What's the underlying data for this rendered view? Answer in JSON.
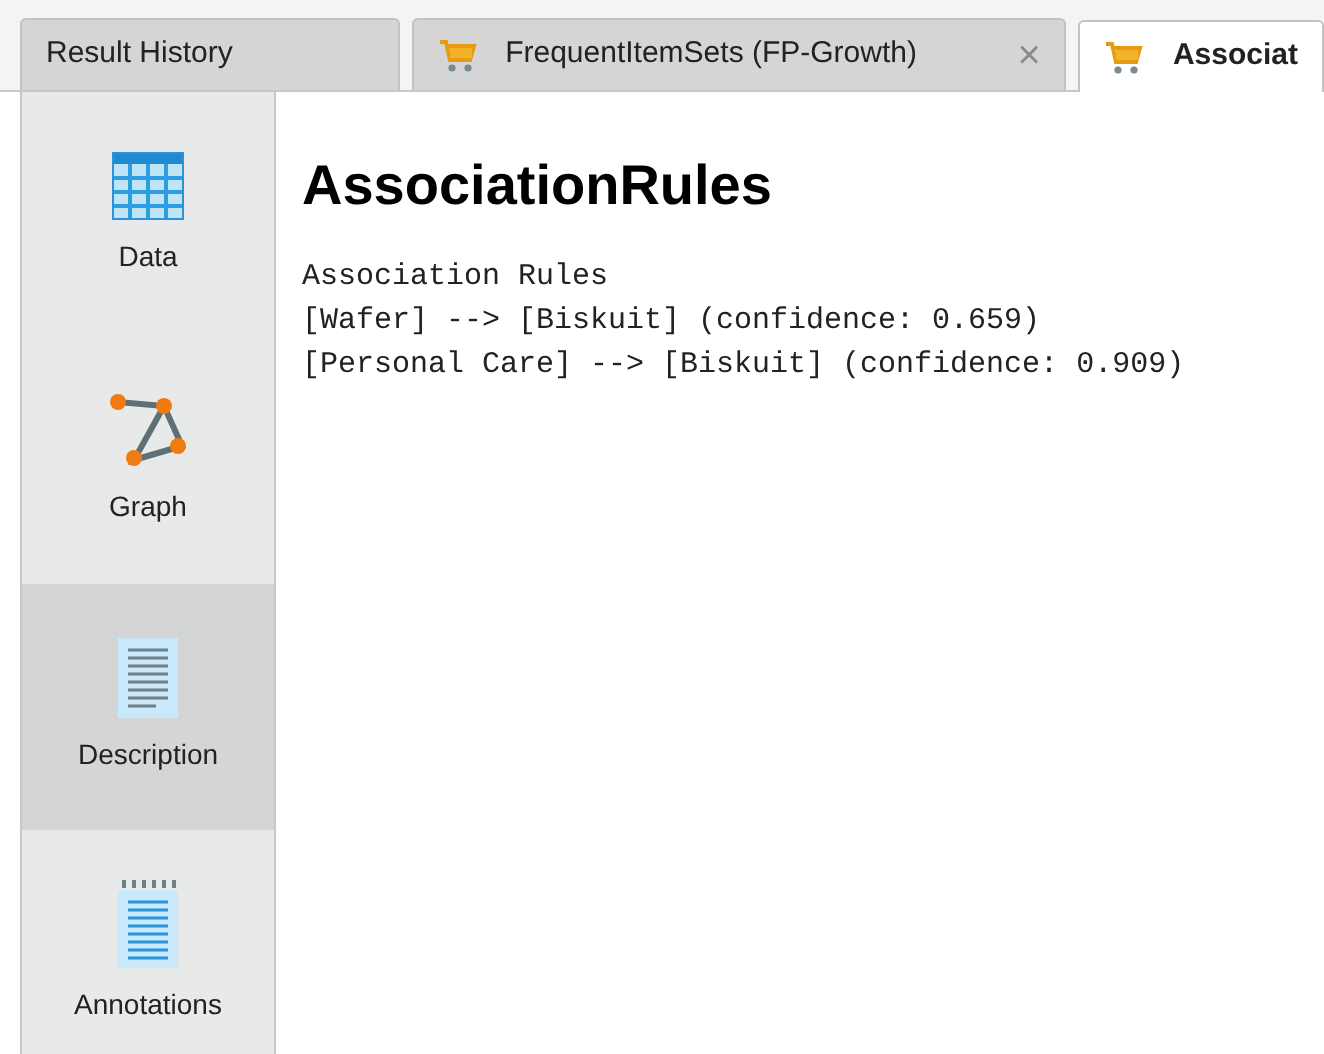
{
  "tabs": [
    {
      "label": "Result History",
      "kind": "history",
      "selected": false
    },
    {
      "label": "FrequentItemSets (FP-Growth)",
      "kind": "result",
      "selected": false,
      "close": "×"
    },
    {
      "label": "Associat",
      "kind": "result",
      "selected": true
    }
  ],
  "sidebar": {
    "items": [
      {
        "label": "Data",
        "kind": "data",
        "selected": false
      },
      {
        "label": "Graph",
        "kind": "graph",
        "selected": false
      },
      {
        "label": "Description",
        "kind": "description",
        "selected": true
      },
      {
        "label": "Annotations",
        "kind": "annotations",
        "selected": false
      }
    ]
  },
  "content": {
    "title": "AssociationRules",
    "lines": [
      "Association Rules",
      "[Wafer] --> [Biskuit] (confidence: 0.659)",
      "[Personal Care] --> [Biskuit] (confidence: 0.909)"
    ]
  }
}
